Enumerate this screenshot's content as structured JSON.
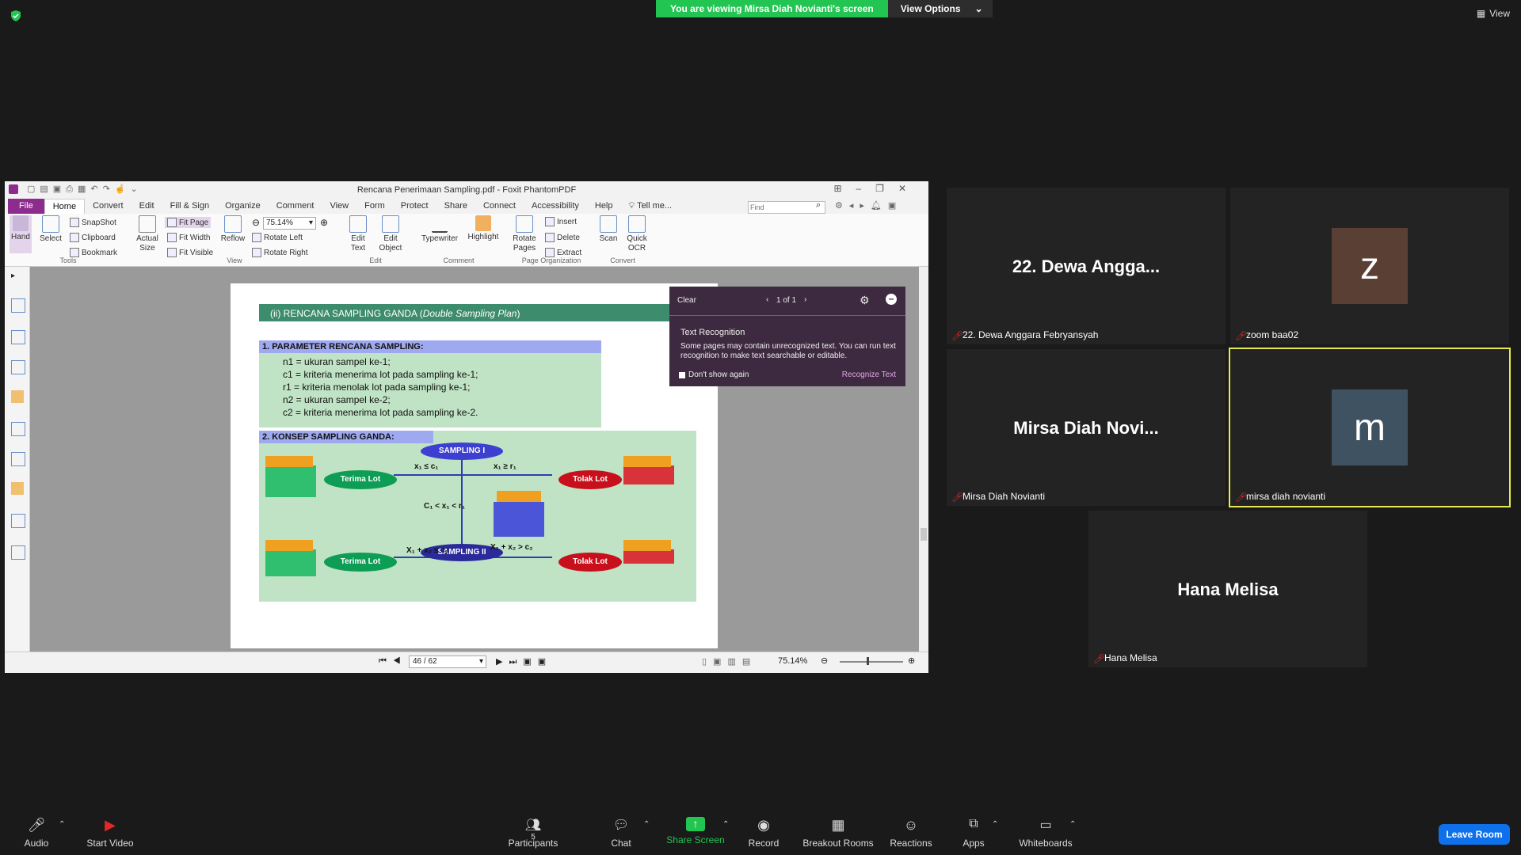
{
  "banner": {
    "text": "You are viewing Mirsa Diah Novianti's screen",
    "options": "View Options"
  },
  "top_right": {
    "view_label": "View"
  },
  "pdf_window": {
    "title": "Rencana Penerimaan Sampling.pdf - Foxit PhantomPDF",
    "tabs": [
      "File",
      "Home",
      "Convert",
      "Edit",
      "Fill & Sign",
      "Organize",
      "Comment",
      "View",
      "Form",
      "Protect",
      "Share",
      "Connect",
      "Accessibility",
      "Help"
    ],
    "tell_me": "Tell me...",
    "find_placeholder": "Find",
    "ribbon": {
      "hand": "Hand",
      "select": "Select",
      "snapshot": "SnapShot",
      "clipboard": "Clipboard",
      "bookmark": "Bookmark",
      "actual_size": "Actual Size",
      "fit_page": "Fit Page",
      "fit_width": "Fit Width",
      "fit_visible": "Fit Visible",
      "reflow": "Reflow",
      "zoom_value": "75.14%",
      "rotate_left": "Rotate Left",
      "rotate_right": "Rotate Right",
      "edit_text": "Edit Text",
      "edit_object": "Edit Object",
      "typewriter": "Typewriter",
      "highlight": "Highlight",
      "rotate_pages": "Rotate Pages",
      "insert": "Insert",
      "delete": "Delete",
      "extract": "Extract",
      "scan": "Scan",
      "quick_ocr": "Quick OCR",
      "groups": {
        "tools": "Tools",
        "view": "View",
        "edit": "Edit",
        "comment": "Comment",
        "page_org": "Page Organization",
        "convert": "Convert"
      }
    },
    "ocr_popup": {
      "clear": "Clear",
      "pager": "1 of 1",
      "heading": "Text Recognition",
      "body": "Some pages may contain unrecognized text. You can run text recognition to make text searchable or editable.",
      "dont_show": "Don't show again",
      "action": "Recognize Text"
    },
    "slide": {
      "header": "(ii) RENCANA SAMPLING GANDA (",
      "header_italic": "Double Sampling Plan",
      "header_end": ")",
      "param_title": "1. PARAMETER RENCANA SAMPLING:",
      "params": [
        "n1 = ukuran sampel ke-1;",
        "c1 = kriteria menerima lot pada sampling ke-1;",
        "r1 = kriteria menolak lot pada sampling ke-1;",
        "n2 = ukuran sampel ke-2;",
        "c2 = kriteria menerima lot pada sampling ke-2."
      ],
      "konsep_title": "2. KONSEP SAMPLING GANDA:",
      "sampling1": "SAMPLING I",
      "sampling2": "SAMPLING II",
      "terima": "Terima Lot",
      "tolak": "Tolak Lot",
      "cond1": "x₁ ≤ c₁",
      "cond2": "x₁ ≥ r₁",
      "cond3": "C₁ < x₁ < r₁",
      "cond4": "X₁ + x₂ ≤ c₂",
      "cond5": "X₁ + x₂ > c₂"
    },
    "status": {
      "page": "46 / 62",
      "zoom": "75.14%"
    }
  },
  "participants": [
    {
      "tile_name": "22. Dewa Angga...",
      "label": "22. Dewa Anggara Febryansyah"
    },
    {
      "avatar_letter": "z",
      "label": "zoom baa02",
      "avatar_color": "#5a3f34"
    },
    {
      "tile_name": "Mirsa Diah Novi...",
      "label": "Mirsa Diah Novianti"
    },
    {
      "avatar_letter": "m",
      "label": "mirsa diah novianti",
      "avatar_color": "#3e5261"
    },
    {
      "tile_name": "Hana Melisa",
      "label": "Hana Melisa"
    }
  ],
  "toolbar": {
    "audio": "Audio",
    "start_video": "Start Video",
    "participants": "Participants",
    "participants_count": "5",
    "chat": "Chat",
    "share_screen": "Share Screen",
    "record": "Record",
    "breakout": "Breakout Rooms",
    "reactions": "Reactions",
    "apps": "Apps",
    "whiteboards": "Whiteboards",
    "leave": "Leave Room"
  }
}
